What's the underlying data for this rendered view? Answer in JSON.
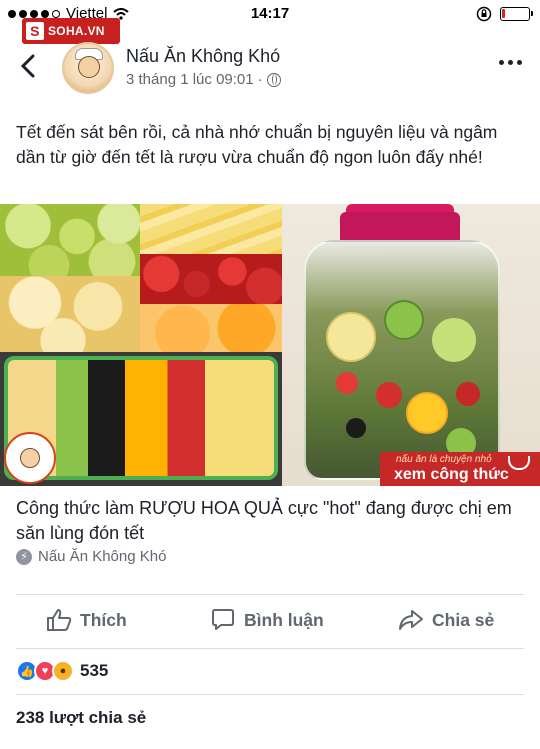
{
  "status_bar": {
    "carrier": "Viettel",
    "time": "14:17",
    "battery_level": 0.12,
    "battery_color": "#e2231a"
  },
  "watermark": {
    "label": "SOHA.VN",
    "icon_letter": "S"
  },
  "header": {
    "page_name": "Nấu Ăn Không Khó",
    "timestamp": "3 tháng 1 lúc 09:01 ·",
    "back_icon": "chevron-left-icon",
    "privacy_icon": "globe-icon",
    "more_icon": "ellipsis-icon"
  },
  "post": {
    "caption": "Tết đến sát bên rồi, cả nhà nhớ chuẩn bị nguyên liệu và ngâm dần từ giờ đến tết là rượu vừa chuẩn độ ngon luôn đấy nhé!"
  },
  "media": {
    "overlay_small": "nấu ăn là chuyện nhỏ",
    "overlay_cta": "xem công thức",
    "brand_color": "#c62828"
  },
  "link_preview": {
    "title": "Công thức làm RƯỢU HOA QUẢ cực \"hot\" đang được chị em săn lùng đón tết",
    "source": "Nấu Ăn Không Khó"
  },
  "actions": {
    "like_label": "Thích",
    "comment_label": "Bình luận",
    "share_label": "Chia sẻ"
  },
  "engagement": {
    "reaction_count": "535",
    "reactions": [
      "like-icon",
      "love-icon",
      "wow-icon"
    ],
    "shares_text": "238 lượt chia sẻ"
  }
}
